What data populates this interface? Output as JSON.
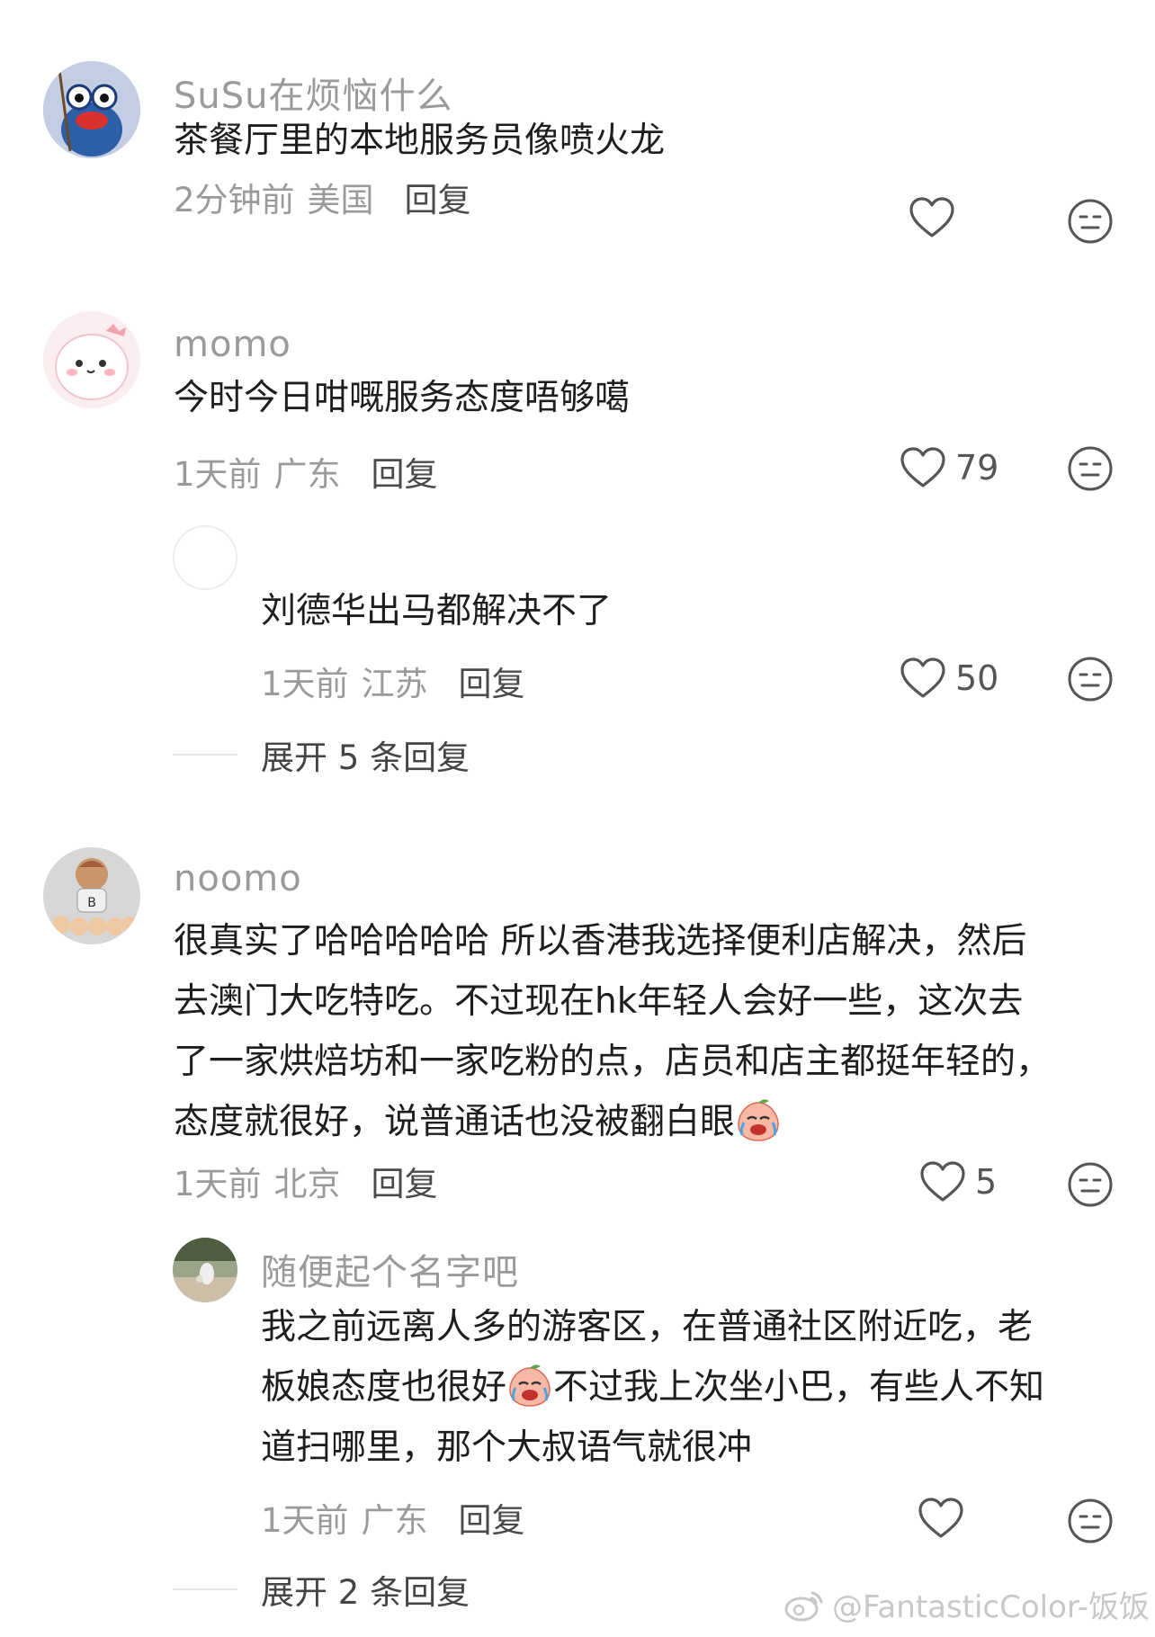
{
  "comments": [
    {
      "user": "SuSu在烦恼什么",
      "text": "茶餐厅里的本地服务员像喷火龙",
      "time": "2分钟前",
      "location": "美国",
      "reply_label": "回复",
      "likes": ""
    },
    {
      "user": "momo",
      "text": "今时今日咁嘅服务态度唔够噶",
      "time": "1天前",
      "location": "广东",
      "reply_label": "回复",
      "likes": "79",
      "reply": {
        "user": "",
        "text": "刘德华出马都解决不了",
        "time": "1天前",
        "location": "江苏",
        "reply_label": "回复",
        "likes": "50"
      },
      "expand_label": "展开 5 条回复"
    },
    {
      "user": "noomo",
      "text_lines": [
        "很真实了哈哈哈哈哈 所以香港我选择便利店解决，然后",
        "去澳门大吃特吃。不过现在hk年轻人会好一些，这次去",
        "了一家烘焙坊和一家吃粉的点，店员和店主都挺年轻的，",
        "态度就很好，说普通话也没被翻白眼"
      ],
      "time": "1天前",
      "location": "北京",
      "reply_label": "回复",
      "likes": "5",
      "reply": {
        "user": "随便起个名字吧",
        "text_lines": [
          "我之前远离人多的游客区，在普通社区附近吃，老",
          "板娘态度也很好",
          "不过我上次坐小巴，有些人不知",
          "道扫哪里，那个大叔语气就很冲"
        ],
        "time": "1天前",
        "location": "广东",
        "reply_label": "回复",
        "likes": ""
      },
      "expand_label": "展开 2 条回复"
    }
  ],
  "icons": {
    "like": "heart-outline-icon",
    "dislike": "neutral-face-icon",
    "emoji": "crying-laughing-peach-emoji"
  },
  "watermark": "@FantasticColor-饭饭"
}
